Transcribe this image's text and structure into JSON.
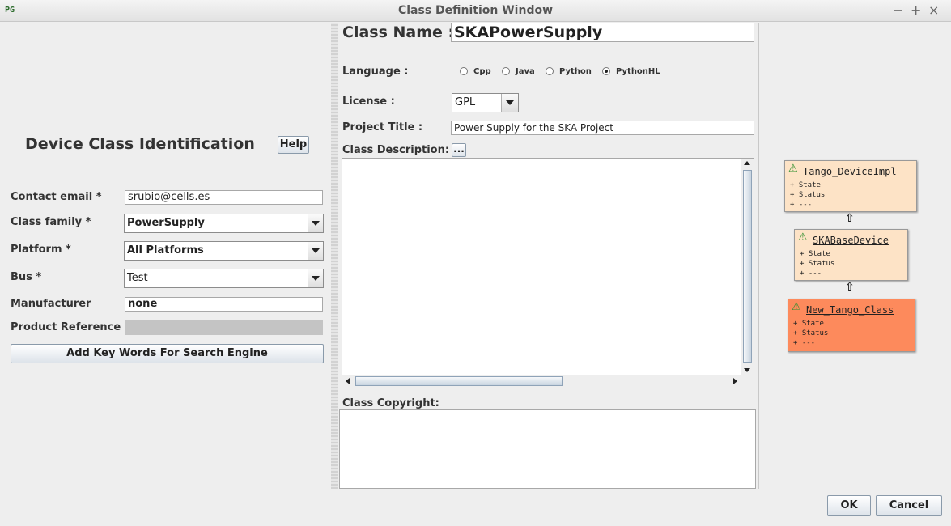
{
  "window": {
    "title": "Class Definition Window",
    "app_icon": "PG",
    "minimize": "−",
    "maximize": "+",
    "close": "×"
  },
  "left": {
    "heading": "Device Class Identification",
    "help": "Help",
    "fields": {
      "contact_label": "Contact email *",
      "contact_value": "srubio@cells.es",
      "family_label": "Class family *",
      "family_value": "PowerSupply",
      "platform_label": "Platform *",
      "platform_value": "All Platforms",
      "bus_label": "Bus *",
      "bus_value": "Test",
      "manufacturer_label": "Manufacturer",
      "manufacturer_value": "none",
      "product_label": "Product Reference",
      "product_value": ""
    },
    "keywords_button": "Add Key Words For Search Engine"
  },
  "center": {
    "class_name_label": "Class Name :",
    "class_name_value": "SKAPowerSupply",
    "language_label": "Language :",
    "languages": [
      "Cpp",
      "Java",
      "Python",
      "PythonHL"
    ],
    "selected_language": "PythonHL",
    "license_label": "License :",
    "license_value": "GPL",
    "project_title_label": "Project Title :",
    "project_title_value": "Power Supply for the SKA Project",
    "description_label": "Class Description:",
    "description_button": "...",
    "description_value": "",
    "copyright_label": "Class Copyright:",
    "copyright_value": ""
  },
  "diagram": {
    "classes": [
      {
        "name": "Tango_DeviceImpl",
        "attrs": [
          "+ State",
          "+ Status",
          "+ ---"
        ]
      },
      {
        "name": "SKABaseDevice",
        "attrs": [
          "+ State",
          "+ Status",
          "+ ---"
        ]
      },
      {
        "name": "New_Tango_Class",
        "attrs": [
          "+ State",
          "+ Status",
          "+ ---"
        ]
      }
    ],
    "colors": {
      "parent_fill": "#fde3c6",
      "new_class_fill": "#fd8a5c"
    }
  },
  "footer": {
    "ok": "OK",
    "cancel": "Cancel"
  }
}
